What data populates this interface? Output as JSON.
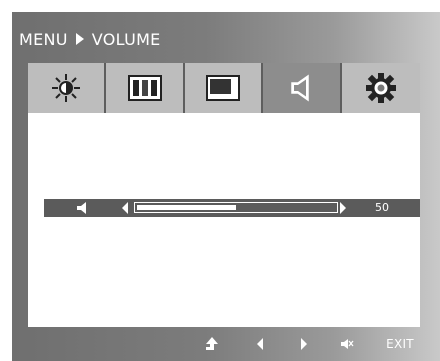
{
  "header": {
    "menu": "MENU",
    "current": "VOLUME"
  },
  "tabs": [
    {
      "name": "brightness",
      "icon": "sun-icon"
    },
    {
      "name": "picture",
      "icon": "picture-icon"
    },
    {
      "name": "position",
      "icon": "position-icon"
    },
    {
      "name": "volume",
      "icon": "speaker-icon",
      "active": true
    },
    {
      "name": "settings",
      "icon": "gear-icon"
    }
  ],
  "volume": {
    "value": "50",
    "level_percent": 50
  },
  "footer": {
    "exit_label": "EXIT"
  },
  "colors": {
    "panel_dark": "#5b5b5b",
    "tab_bg": "#bdbdbd",
    "tab_active": "#8d8d8d",
    "text": "#ffffff"
  }
}
